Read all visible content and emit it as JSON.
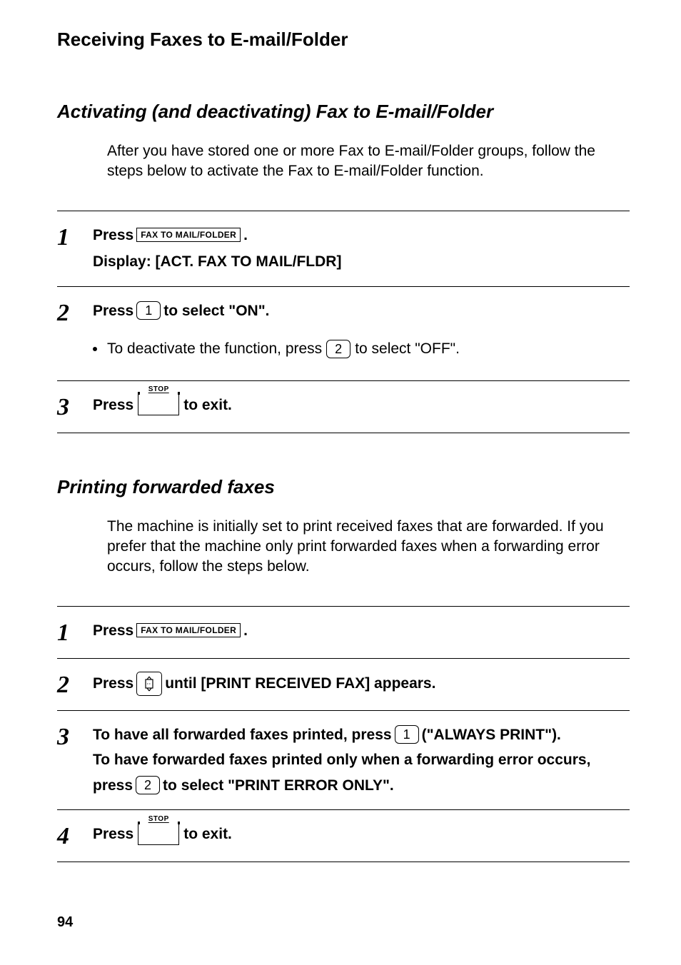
{
  "header": {
    "title": "Receiving Faxes to E-mail/Folder"
  },
  "section1": {
    "heading": "Activating (and deactivating) Fax to E-mail/Folder",
    "intro": "After you have stored one or more Fax to E-mail/Folder groups, follow the steps below to activate the Fax to E-mail/Folder function.",
    "steps": [
      {
        "num": "1",
        "press": "Press ",
        "key_label": "FAX TO MAIL/FOLDER",
        "after_key": ".",
        "display_line": "Display: [ACT. FAX TO MAIL/FLDR]"
      },
      {
        "num": "2",
        "press": "Press ",
        "key_num": "1",
        "after_key": " to select \"ON\".",
        "bullet_pre": "To deactivate the function, press ",
        "bullet_key": "2",
        "bullet_post": " to select \"OFF\"."
      },
      {
        "num": "3",
        "press": "Press ",
        "stop_label": "STOP",
        "after_key": " to exit."
      }
    ]
  },
  "section2": {
    "heading": "Printing forwarded faxes",
    "intro": "The machine is initially set to print received faxes that are forwarded. If you prefer that the machine only print forwarded faxes when a forwarding error occurs, follow the steps below.",
    "steps": [
      {
        "num": "1",
        "press": "Press ",
        "key_label": "FAX TO MAIL/FOLDER",
        "after_key": "."
      },
      {
        "num": "2",
        "press": "Press ",
        "after_key": " until [PRINT RECEIVED FAX] appears."
      },
      {
        "num": "3",
        "line1_a": "To have all forwarded faxes printed, press ",
        "line1_key": "1",
        "line1_b": " (\"ALWAYS PRINT\").",
        "line2": "To have forwarded faxes printed only when a forwarding error occurs,",
        "line3_a": "press ",
        "line3_key": "2",
        "line3_b": " to select \"PRINT ERROR ONLY\"."
      },
      {
        "num": "4",
        "press": "Press ",
        "stop_label": "STOP",
        "after_key": " to exit."
      }
    ]
  },
  "page_number": "94"
}
